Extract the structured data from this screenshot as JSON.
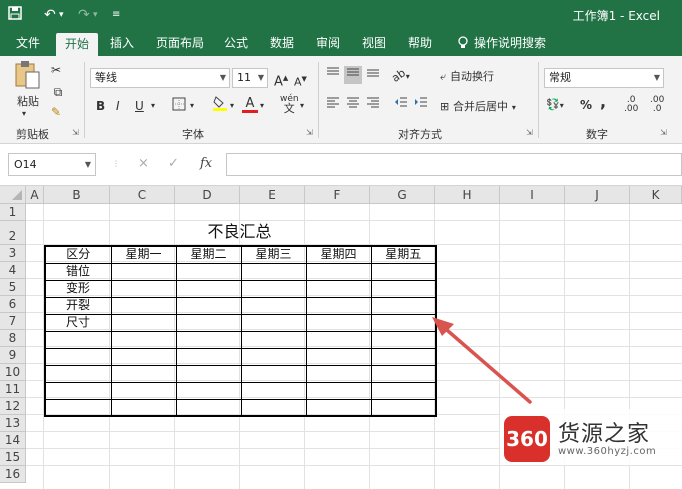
{
  "title_bar": {
    "save_icon": "save-icon",
    "undo_icon": "undo-icon",
    "redo_icon": "redo-icon",
    "customize_icon": "customize-quick-access-icon",
    "document_title": "工作簿1 - Excel"
  },
  "menu_tabs": [
    {
      "label": "文件"
    },
    {
      "label": "开始",
      "active": true
    },
    {
      "label": "插入"
    },
    {
      "label": "页面布局"
    },
    {
      "label": "公式"
    },
    {
      "label": "数据"
    },
    {
      "label": "审阅"
    },
    {
      "label": "视图"
    },
    {
      "label": "帮助"
    },
    {
      "label": "操作说明搜索",
      "icon": "lightbulb-icon"
    }
  ],
  "ribbon": {
    "clipboard": {
      "paste_label": "粘贴",
      "group_label": "剪贴板"
    },
    "font": {
      "font_name": "等线",
      "font_size": "11",
      "group_label": "字体",
      "bold": "B",
      "italic": "I",
      "underline": "U",
      "grow": "A",
      "shrink": "A",
      "fill_color": "#ffff00",
      "font_color": "#e02020",
      "wen": "wén"
    },
    "alignment": {
      "wrap_text": "自动换行",
      "merge_center": "合并后居中",
      "group_label": "对齐方式"
    },
    "number": {
      "format": "常规",
      "group_label": "数字",
      "percent": "%",
      "comma": ",",
      "inc_dec": ".00",
      "dec_dec": ".0"
    }
  },
  "formula_bar": {
    "name_box": "O14",
    "cancel_icon": "×",
    "enter_icon": "✓",
    "fx_label": "fx",
    "formula": ""
  },
  "sheet": {
    "columns": [
      "A",
      "B",
      "C",
      "D",
      "E",
      "F",
      "G",
      "H",
      "I",
      "J",
      "K"
    ],
    "rows": [
      "1",
      "2",
      "3",
      "4",
      "5",
      "6",
      "7",
      "8",
      "9",
      "10",
      "11",
      "12",
      "13",
      "14",
      "15",
      "16"
    ],
    "title": "不良汇总",
    "table_headers": [
      "区分",
      "星期一",
      "星期二",
      "星期三",
      "星期四",
      "星期五"
    ],
    "table_rows": [
      [
        "错位",
        "",
        "",
        "",
        "",
        ""
      ],
      [
        "变形",
        "",
        "",
        "",
        "",
        ""
      ],
      [
        "开裂",
        "",
        "",
        "",
        "",
        ""
      ],
      [
        "尺寸",
        "",
        "",
        "",
        "",
        ""
      ],
      [
        "",
        "",
        "",
        "",
        "",
        ""
      ],
      [
        "",
        "",
        "",
        "",
        "",
        ""
      ],
      [
        "",
        "",
        "",
        "",
        "",
        ""
      ],
      [
        "",
        "",
        "",
        "",
        "",
        ""
      ],
      [
        "",
        "",
        "",
        "",
        "",
        ""
      ]
    ]
  },
  "annotation": {
    "arrow_color": "#d9534f"
  },
  "watermark": {
    "logo_text": "360",
    "site_name": "货源之家",
    "url": "www.360hyzj.com"
  }
}
